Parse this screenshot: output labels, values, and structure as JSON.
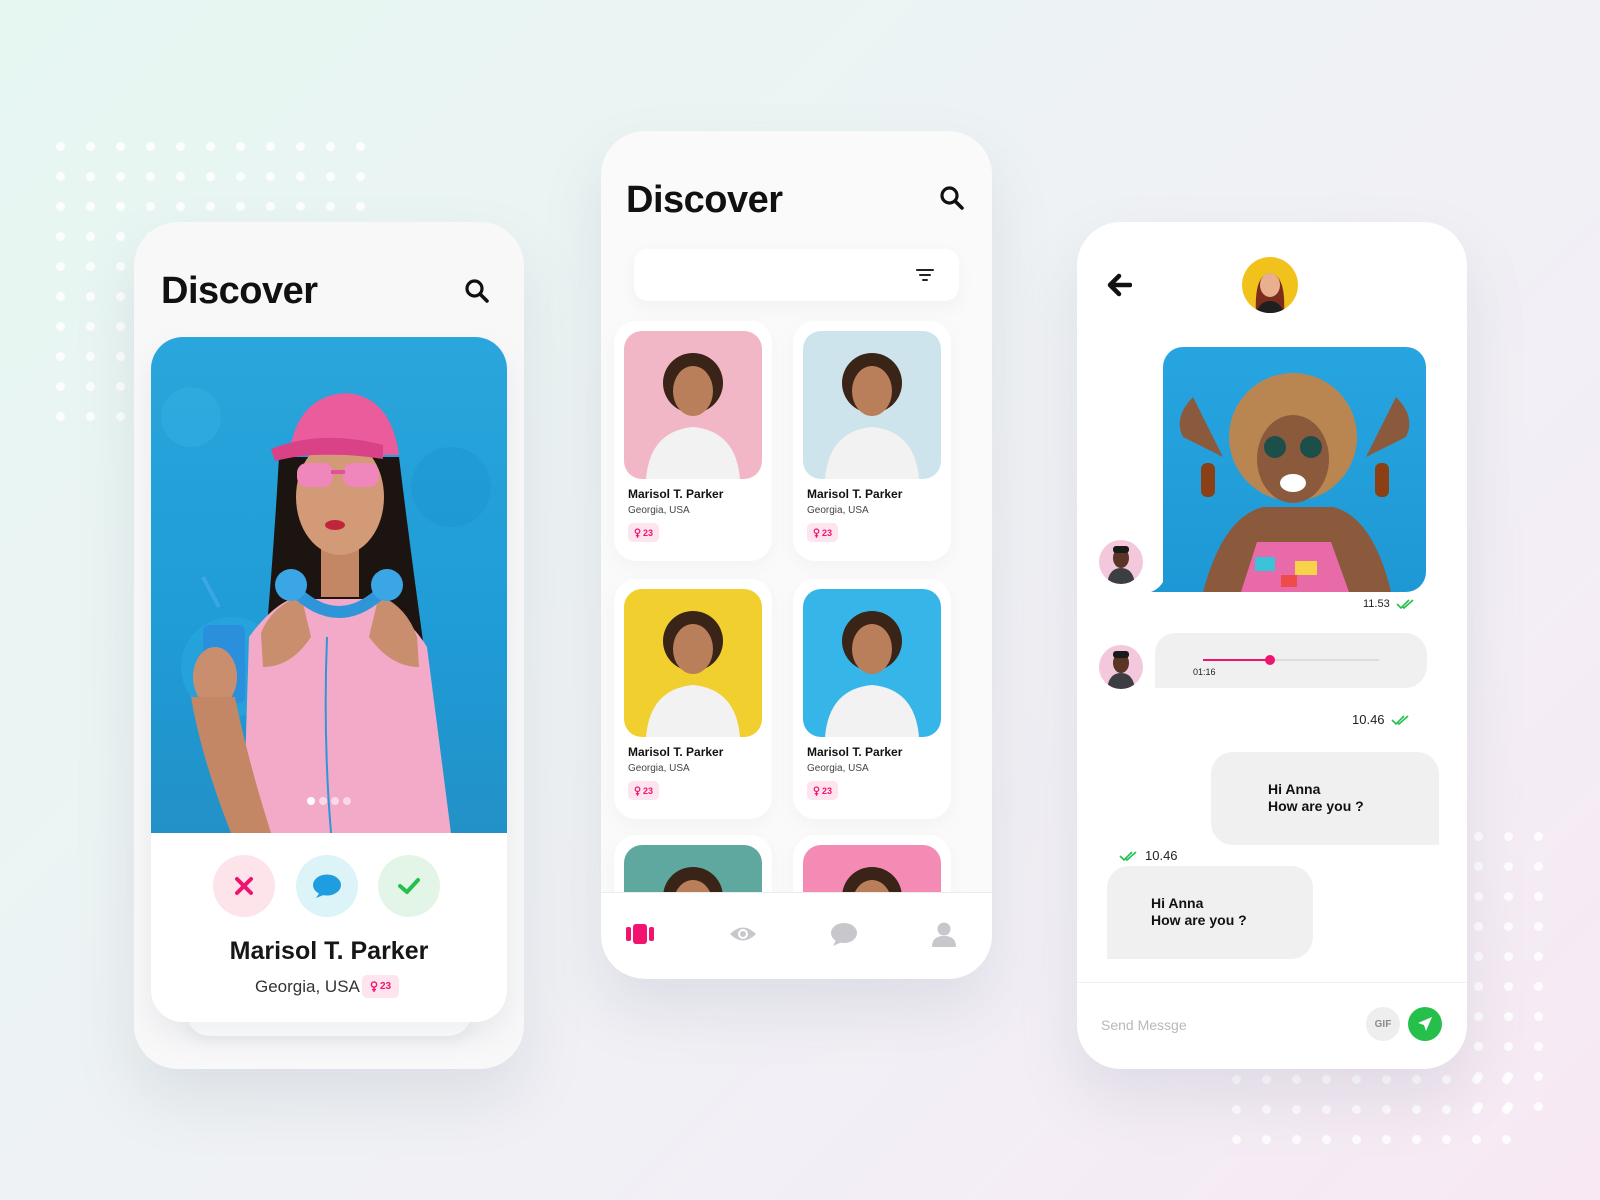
{
  "colors": {
    "accent_pink": "#f0146e",
    "send_green": "#25c04c",
    "bubble_grey": "#f0f0f1"
  },
  "screen_discover_card": {
    "title": "Discover",
    "search_icon": "search-icon",
    "profile": {
      "name": "Marisol T. Parker",
      "location": "Georgia, USA",
      "age": "23"
    },
    "photo_pager": {
      "count": 4,
      "active": 1
    },
    "actions": [
      {
        "name": "dislike",
        "icon": "close-icon",
        "bg": "#fde3ea",
        "color": "#f0146e"
      },
      {
        "name": "message",
        "icon": "chat-bubble-icon",
        "bg": "#dcf3f7",
        "color": "#1e9ee0"
      },
      {
        "name": "like",
        "icon": "check-icon",
        "bg": "#e2f5e6",
        "color": "#25c04c"
      }
    ]
  },
  "screen_discover_grid": {
    "title": "Discover",
    "search_icon": "search-icon",
    "filter_icon": "filter-icon",
    "profiles": [
      {
        "name": "Marisol T. Parker",
        "location": "Georgia, USA",
        "age": "23",
        "photo_bg": "#f2b7c6"
      },
      {
        "name": "Marisol T. Parker",
        "location": "Georgia, USA",
        "age": "23",
        "photo_bg": "#cde4ec"
      },
      {
        "name": "Marisol T. Parker",
        "location": "Georgia, USA",
        "age": "23",
        "photo_bg": "#f0cf2e"
      },
      {
        "name": "Marisol T. Parker",
        "location": "Georgia, USA",
        "age": "23",
        "photo_bg": "#36b6e8"
      },
      {
        "photo_bg": "#5fa8a0"
      },
      {
        "photo_bg": "#f48bb4"
      }
    ],
    "nav": [
      {
        "icon": "cards-icon",
        "active": true
      },
      {
        "icon": "eye-icon",
        "active": false
      },
      {
        "icon": "chat-icon",
        "active": false
      },
      {
        "icon": "profile-icon",
        "active": false
      }
    ]
  },
  "screen_chat": {
    "back_icon": "back-arrow-icon",
    "messages": {
      "image_time": "11.53",
      "audio_duration": "01:16",
      "audio_progress": 0.38,
      "out_time": "10.46",
      "out_text_line1": "Hi Anna",
      "out_text_line2": "How are you ?",
      "in_time": "10.46",
      "in_text_line1": "Hi Anna",
      "in_text_line2": "How are you ?"
    },
    "compose": {
      "placeholder": "Send Messge",
      "gif_label": "GIF",
      "send_icon": "send-icon"
    }
  }
}
